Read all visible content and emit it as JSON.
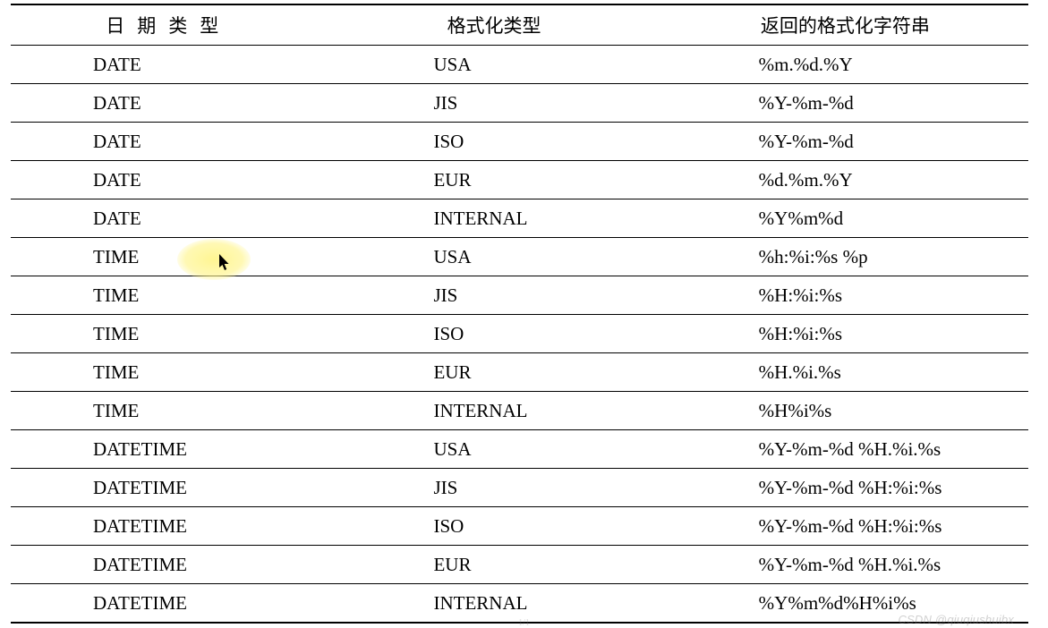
{
  "watermark": "CSDN @qiuqiushuibx",
  "tinymark": "1/1",
  "table": {
    "headers": [
      "日期类型",
      "格式化类型",
      "返回的格式化字符串"
    ],
    "rows": [
      {
        "c1": "DATE",
        "c2": "USA",
        "c3": "%m.%d.%Y"
      },
      {
        "c1": "DATE",
        "c2": "JIS",
        "c3": "%Y-%m-%d"
      },
      {
        "c1": "DATE",
        "c2": "ISO",
        "c3": "%Y-%m-%d"
      },
      {
        "c1": "DATE",
        "c2": "EUR",
        "c3": "%d.%m.%Y"
      },
      {
        "c1": "DATE",
        "c2": "INTERNAL",
        "c3": "%Y%m%d"
      },
      {
        "c1": "TIME",
        "c2": "USA",
        "c3": "%h:%i:%s %p"
      },
      {
        "c1": "TIME",
        "c2": "JIS",
        "c3": "%H:%i:%s"
      },
      {
        "c1": "TIME",
        "c2": "ISO",
        "c3": "%H:%i:%s"
      },
      {
        "c1": "TIME",
        "c2": "EUR",
        "c3": "%H.%i.%s"
      },
      {
        "c1": "TIME",
        "c2": "INTERNAL",
        "c3": "%H%i%s"
      },
      {
        "c1": "DATETIME",
        "c2": "USA",
        "c3": "%Y-%m-%d %H.%i.%s"
      },
      {
        "c1": "DATETIME",
        "c2": "JIS",
        "c3": "%Y-%m-%d %H:%i:%s"
      },
      {
        "c1": "DATETIME",
        "c2": "ISO",
        "c3": "%Y-%m-%d %H:%i:%s"
      },
      {
        "c1": "DATETIME",
        "c2": "EUR",
        "c3": "%Y-%m-%d %H.%i.%s"
      },
      {
        "c1": "DATETIME",
        "c2": "INTERNAL",
        "c3": "%Y%m%d%H%i%s"
      }
    ]
  }
}
